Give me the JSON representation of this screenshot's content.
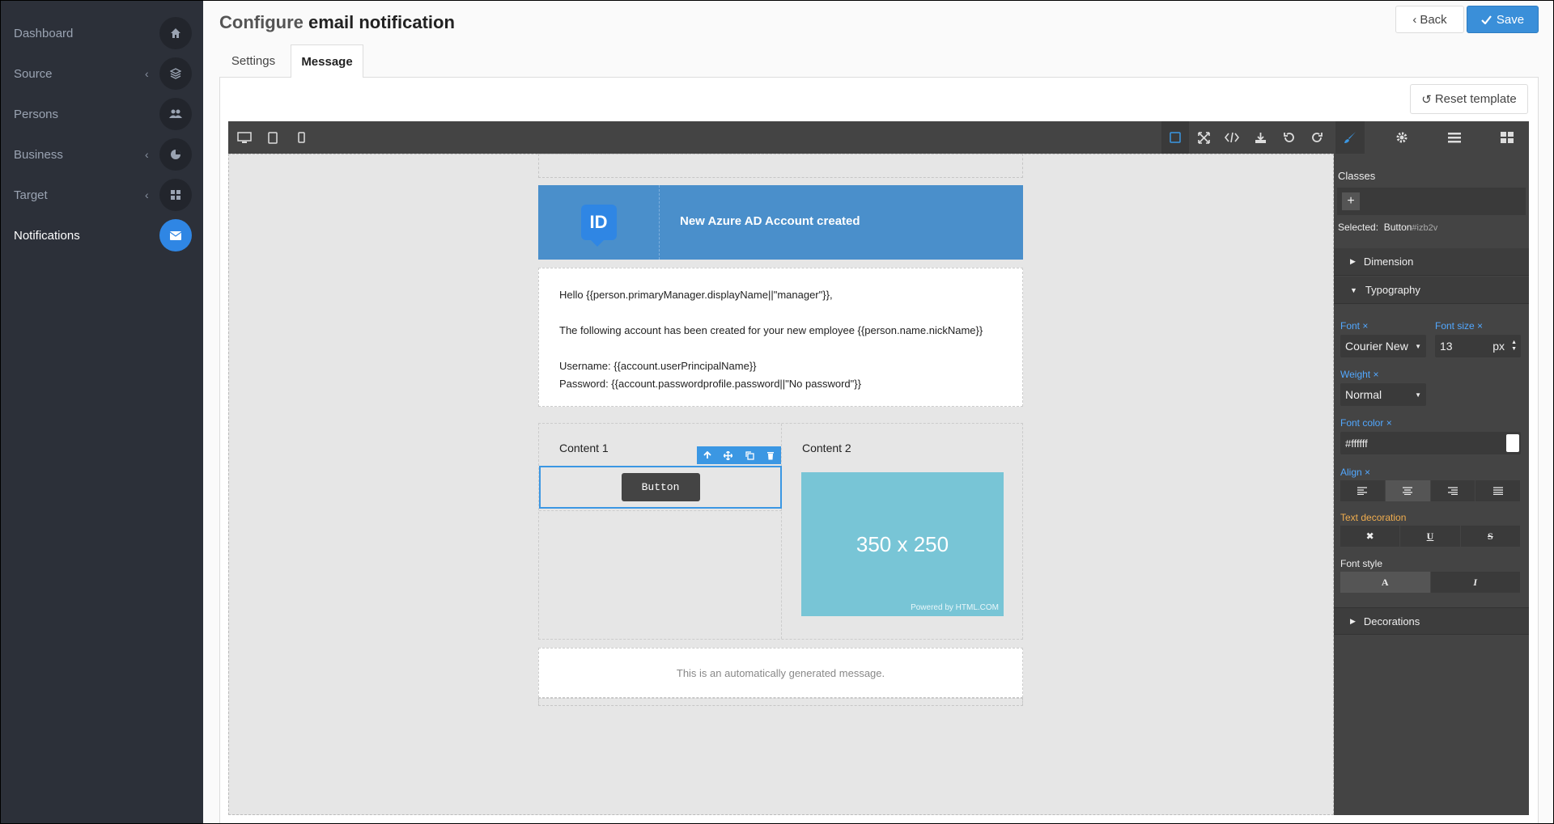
{
  "sidebar": {
    "items": [
      {
        "label": "Dashboard",
        "icon": "home-icon",
        "chevron": false,
        "active": false
      },
      {
        "label": "Source",
        "icon": "layers-icon",
        "chevron": true,
        "active": false
      },
      {
        "label": "Persons",
        "icon": "users-icon",
        "chevron": false,
        "active": false
      },
      {
        "label": "Business",
        "icon": "pie-icon",
        "chevron": true,
        "active": false
      },
      {
        "label": "Target",
        "icon": "grid-icon",
        "chevron": true,
        "active": false
      },
      {
        "label": "Notifications",
        "icon": "envelope-icon",
        "chevron": false,
        "active": true
      }
    ]
  },
  "header": {
    "title_prefix": "Configure ",
    "title_bold": "email notification",
    "back_label": "Back",
    "save_label": "Save"
  },
  "tabs": [
    "Settings",
    "Message"
  ],
  "reset_label": "Reset template",
  "email": {
    "header_title": "New Azure AD Account created",
    "logo_text": "ID",
    "lines": [
      "Hello {{person.primaryManager.displayName||\"manager\"}},",
      "",
      "The following account has been created for your new employee {{person.name.nickName}}",
      "",
      "Username: {{account.userPrincipalName}}",
      "Password: {{account.passwordprofile.password||\"No password\"}}"
    ],
    "content1_title": "Content 1",
    "content2_title": "Content 2",
    "button_label": "Button",
    "placeholder_text": "350 x 250",
    "powered_text": "Powered by HTML.COM",
    "footer_text": "This is an automatically generated message."
  },
  "style_manager": {
    "classes_label": "Classes",
    "selected_label": "Selected:",
    "selected_name": "Button",
    "selected_id": "#izb2v",
    "sections": [
      "Dimension",
      "Typography",
      "Decorations"
    ],
    "font_label": "Font",
    "font_value": "Courier New",
    "font_size_label": "Font size",
    "font_size_value": "13",
    "font_size_unit": "px",
    "weight_label": "Weight",
    "weight_value": "Normal",
    "font_color_label": "Font color",
    "font_color_value": "#ffffff",
    "align_label": "Align",
    "text_decoration_label": "Text decoration",
    "font_style_label": "Font style"
  },
  "colors": {
    "sidebar_bg": "#2c3039",
    "accent": "#2f86e4",
    "email_header": "#4a8fcb",
    "placeholder": "#78c5d6",
    "highlight_label": "#f0ad4e"
  }
}
